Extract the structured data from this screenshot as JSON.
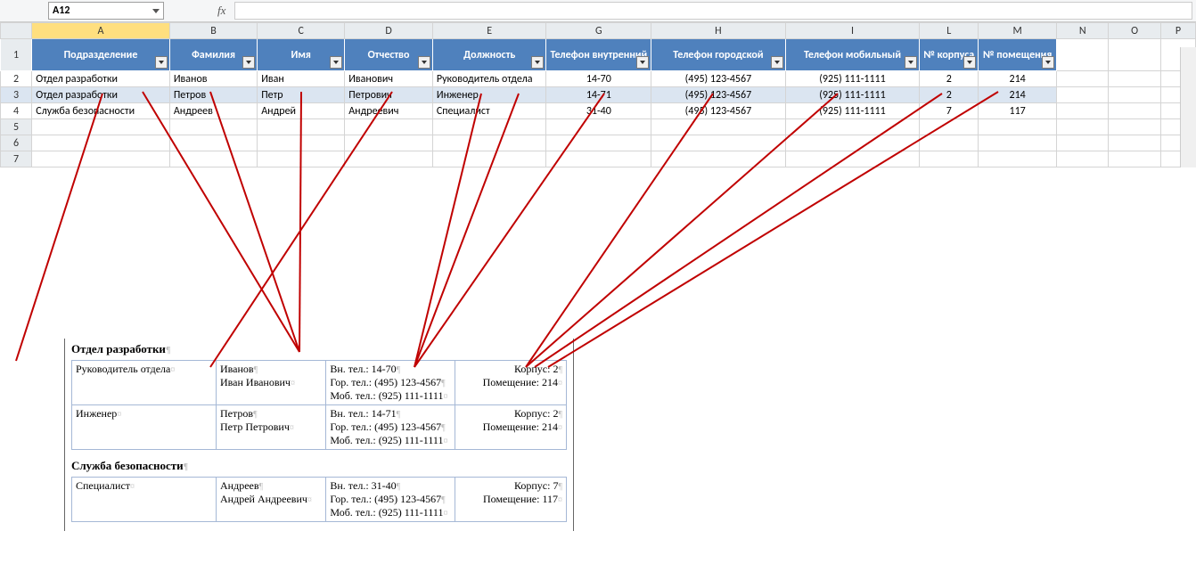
{
  "namebox": {
    "cellref": "A12"
  },
  "fx_label": "fx",
  "columns": [
    "",
    "A",
    "B",
    "C",
    "D",
    "E",
    "G",
    "H",
    "I",
    "L",
    "M",
    "N",
    "O",
    "P"
  ],
  "headers": {
    "A": "Подразделение",
    "B": "Фамилия",
    "C": "Имя",
    "D": "Отчество",
    "E": "Должность",
    "G": "Телефон внутренний",
    "H": "Телефон городской",
    "I": "Телефон мобильный",
    "L": "№ корпуса",
    "M": "№ помещения"
  },
  "rows": [
    {
      "n": 2,
      "A": "Отдел разработки",
      "B": "Иванов",
      "C": "Иван",
      "D": "Иванович",
      "E": "Руководитель отдела",
      "G": "14-70",
      "H": "(495) 123-4567",
      "I": "(925) 111-1111",
      "L": "2",
      "M": "214"
    },
    {
      "n": 3,
      "A": "Отдел разработки",
      "B": "Петров",
      "C": "Петр",
      "D": "Петрович",
      "E": "Инженер",
      "G": "14-71",
      "H": "(495) 123-4567",
      "I": "(925) 111-1111",
      "L": "2",
      "M": "214"
    },
    {
      "n": 4,
      "A": "Служба безопасности",
      "B": "Андреев",
      "C": "Андрей",
      "D": "Андреевич",
      "E": "Специалист",
      "G": "31-40",
      "H": "(495) 123-4567",
      "I": "(925) 111-1111",
      "L": "7",
      "M": "117"
    }
  ],
  "emptyrows": [
    5,
    6,
    7
  ],
  "doc": {
    "groups": [
      {
        "title": "Отдел разработки",
        "rows": [
          {
            "pos": "Руководитель отдела",
            "name1": "Иванов",
            "name2": "Иван Иванович",
            "tel1": "Вн. тел.: 14-70",
            "tel2": "Гор. тел.: (495) 123-4567",
            "tel3": "Моб. тел.: (925) 111-1111",
            "loc1": "Корпус: 2",
            "loc2": "Помещение: 214"
          },
          {
            "pos": "Инженер",
            "name1": "Петров",
            "name2": "Петр Петрович",
            "tel1": "Вн. тел.: 14-71",
            "tel2": "Гор. тел.: (495) 123-4567",
            "tel3": "Моб. тел.: (925) 111-1111",
            "loc1": "Корпус: 2",
            "loc2": "Помещение: 214"
          }
        ]
      },
      {
        "title": "Служба безопасности",
        "rows": [
          {
            "pos": "Специалист",
            "name1": "Андреев",
            "name2": "Андрей Андреевич",
            "tel1": "Вн. тел.: 31-40",
            "tel2": "Гор. тел.: (495) 123-4567",
            "tel3": "Моб. тел.: (925) 111-1111",
            "loc1": "Корпус: 7",
            "loc2": "Помещение: 117"
          }
        ]
      }
    ]
  },
  "colwidths": {
    "rowhead": 36,
    "A": 156,
    "B": 100,
    "C": 100,
    "D": 100,
    "E": 128,
    "G": 88,
    "H": 152,
    "I": 152,
    "L": 54,
    "M": 88,
    "N": 60,
    "O": 60,
    "P": 40
  },
  "annotation_lines": [
    [
      115,
      105,
      18,
      405
    ],
    [
      160,
      103,
      336,
      395
    ],
    [
      236,
      103,
      336,
      395
    ],
    [
      338,
      103,
      336,
      395
    ],
    [
      440,
      103,
      236,
      412
    ],
    [
      540,
      105,
      465,
      412
    ],
    [
      582,
      105,
      465,
      412
    ],
    [
      678,
      105,
      465,
      412
    ],
    [
      800,
      105,
      590,
      412
    ],
    [
      940,
      105,
      590,
      412
    ],
    [
      1057,
      105,
      600,
      412
    ],
    [
      1120,
      103,
      615,
      412
    ]
  ]
}
